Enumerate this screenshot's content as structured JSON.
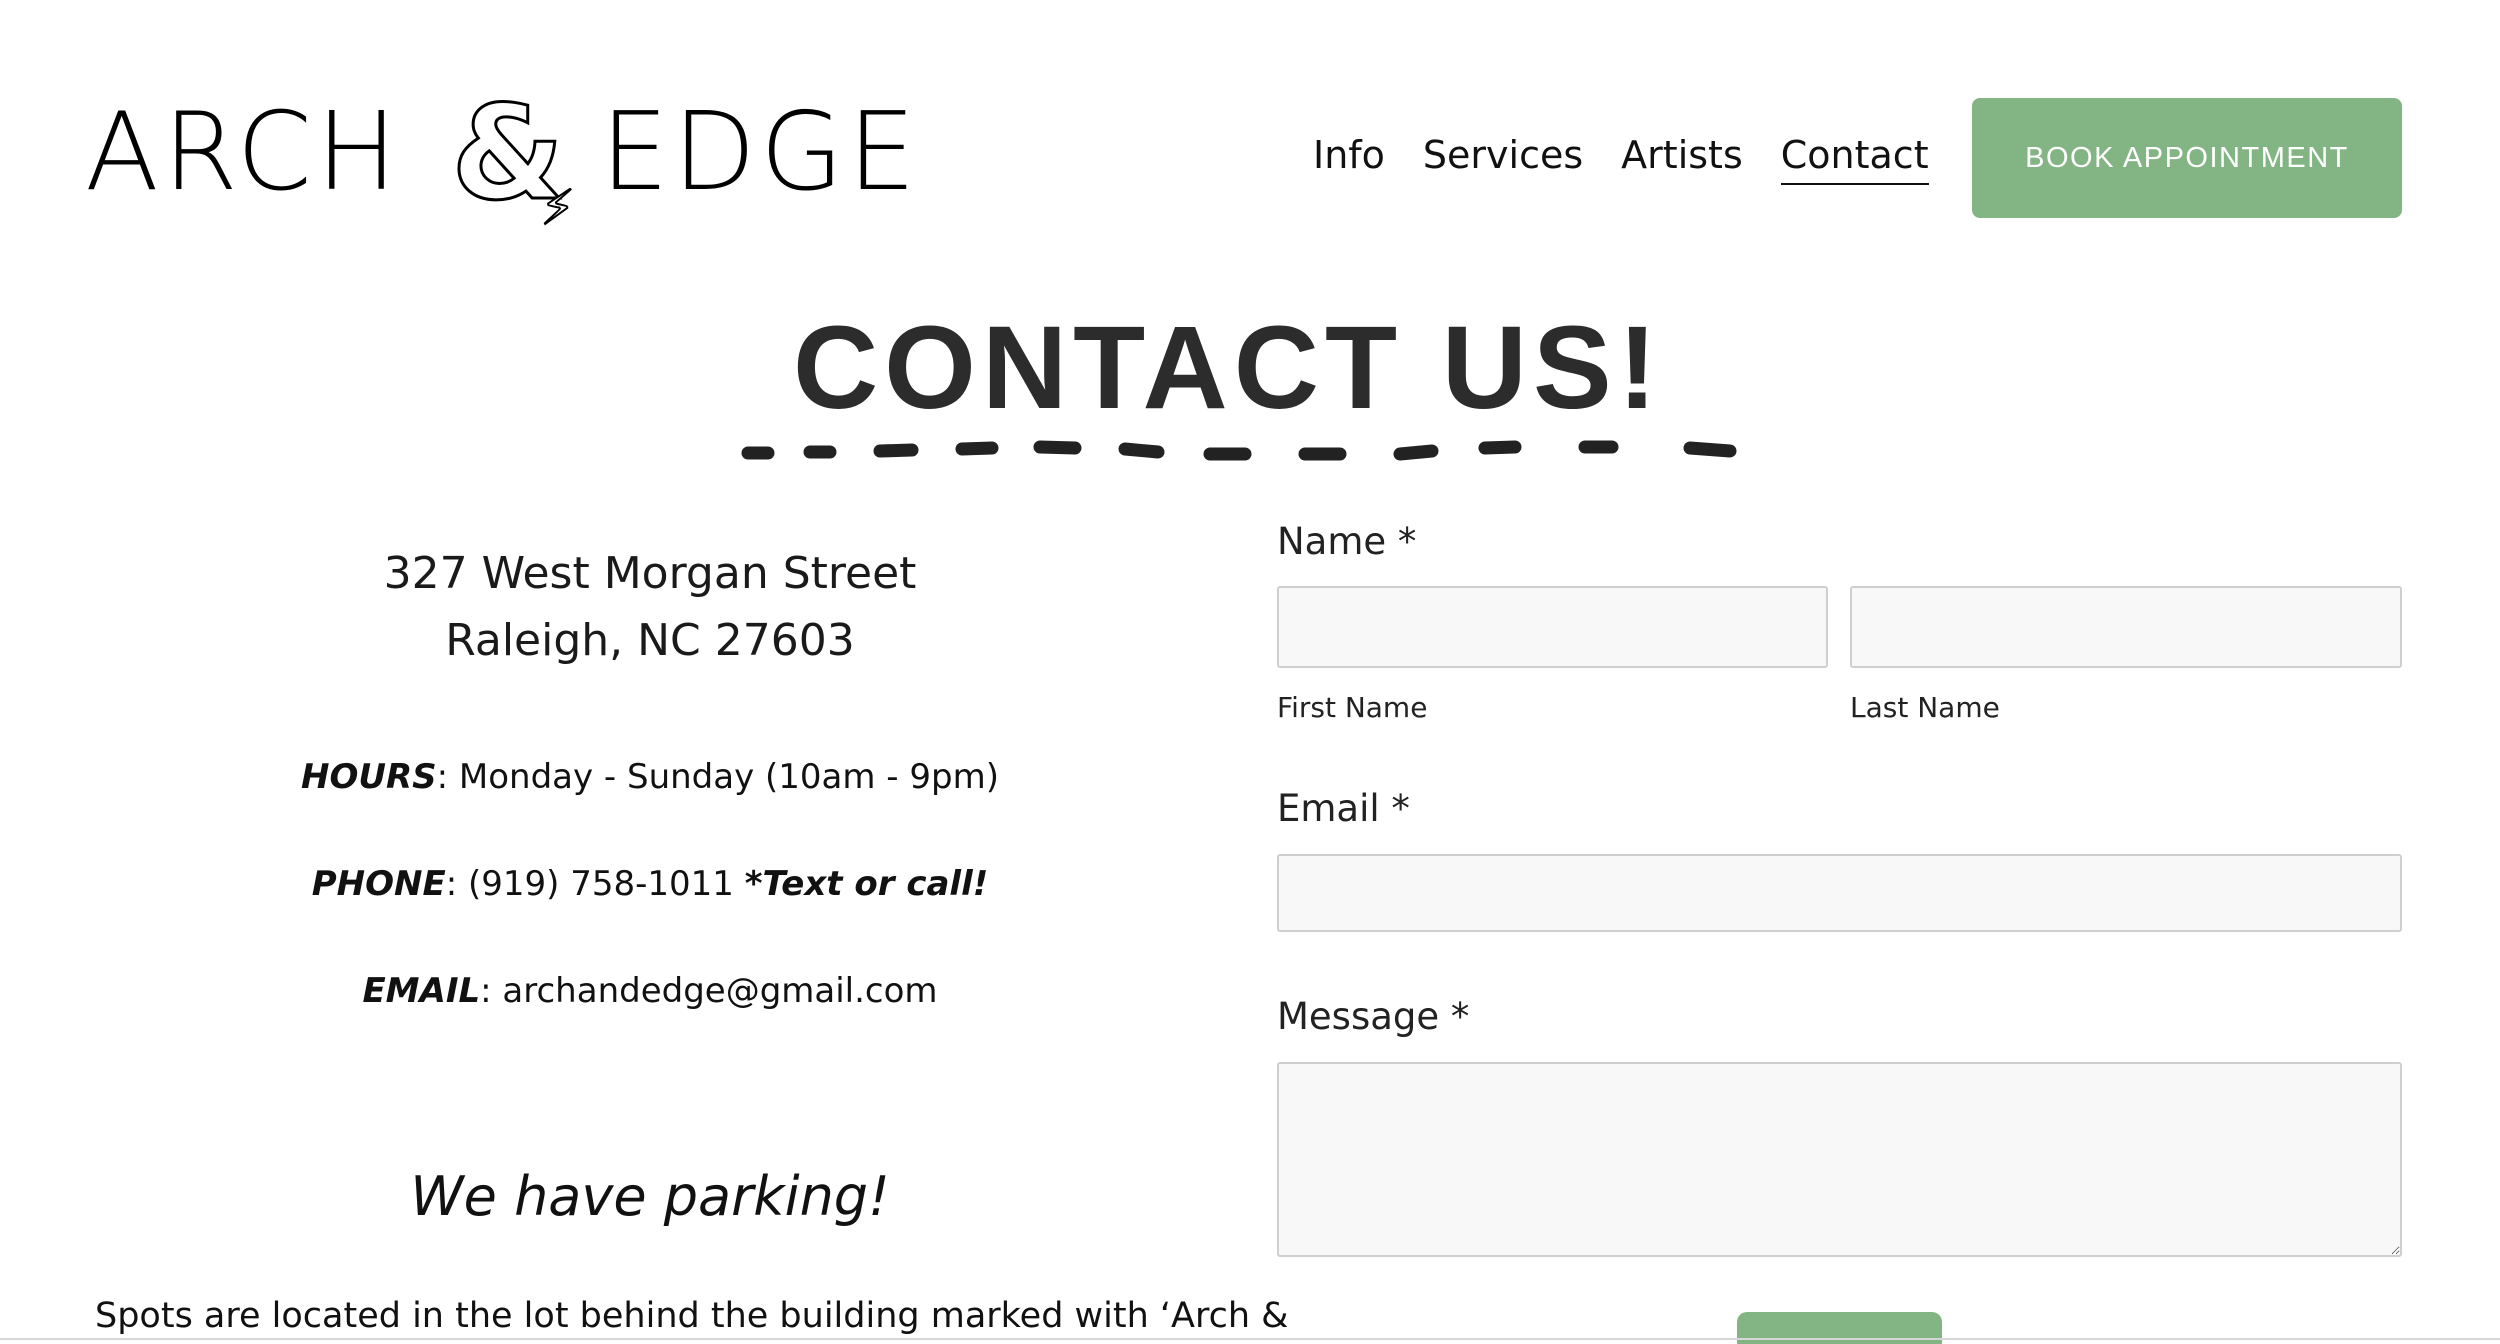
{
  "header": {
    "logo": {
      "word_left": "ARCH",
      "amp": "&",
      "word_right": "EDGE"
    },
    "nav": [
      {
        "label": "Info",
        "active": false
      },
      {
        "label": "Services",
        "active": false
      },
      {
        "label": "Artists",
        "active": false
      },
      {
        "label": "Contact",
        "active": true
      }
    ],
    "book_button": "BOOK APPOINTMENT"
  },
  "title": "CONTACT US!",
  "info": {
    "address_line1": "327 West Morgan Street",
    "address_line2": "Raleigh, NC 27603",
    "hours_label": "HOURS",
    "hours_value": ": Monday - Sunday (10am - 9pm)",
    "phone_label": "PHONE",
    "phone_value": ": (919) 758-1011 ",
    "phone_note": "*Text or call!",
    "email_label": "EMAIL",
    "email_value": ": archandedge@gmail.com",
    "parking_heading": "We have parking!",
    "parking_text": "Spots are located in the lot behind the building marked with ‘Arch &"
  },
  "form": {
    "name_label": "Name *",
    "first_name_label": "First Name",
    "last_name_label": "Last Name",
    "first_name_value": "",
    "last_name_value": "",
    "email_label": "Email *",
    "email_value": "",
    "message_label": "Message *",
    "message_value": ""
  },
  "colors": {
    "accent": "#83b584",
    "title": "#2c2c2c",
    "field_bg": "#f8f8f8",
    "field_border": "#cfcfcf"
  }
}
